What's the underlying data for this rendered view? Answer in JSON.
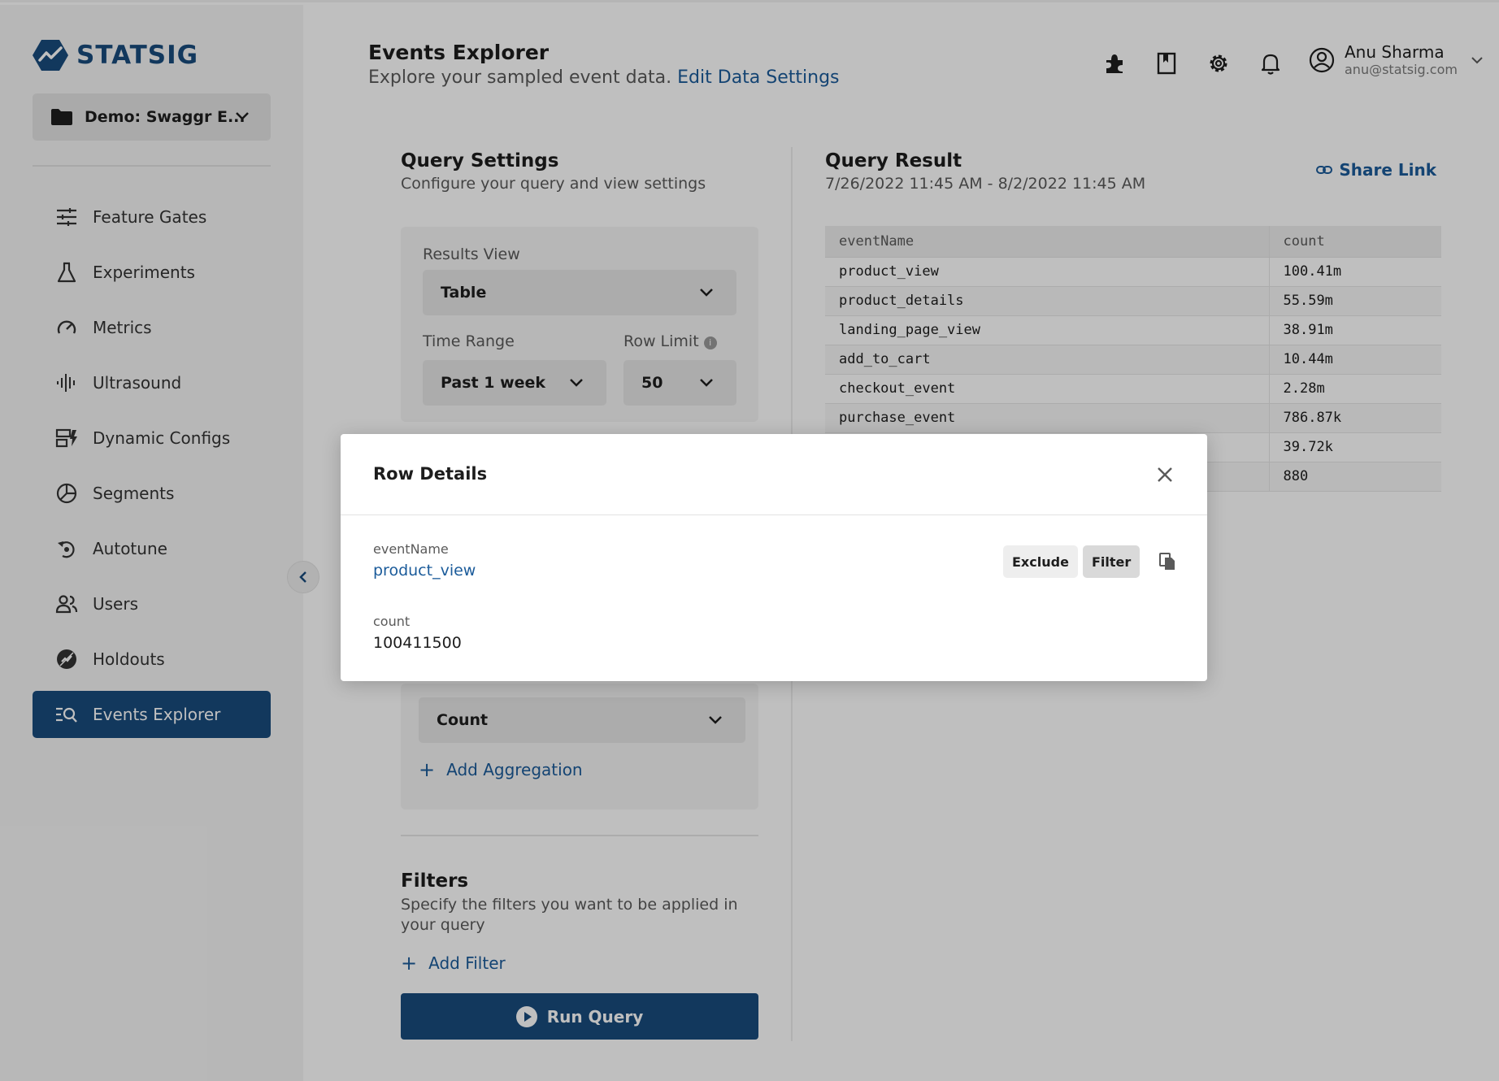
{
  "brand": {
    "name": "STATSIG",
    "color": "#194b7d"
  },
  "project": {
    "name": "Demo: Swaggr E...",
    "icon": "folder-icon"
  },
  "sidebar": {
    "items": [
      {
        "label": "Feature Gates",
        "icon": "feature-gates-icon"
      },
      {
        "label": "Experiments",
        "icon": "flask-icon"
      },
      {
        "label": "Metrics",
        "icon": "gauge-icon"
      },
      {
        "label": "Ultrasound",
        "icon": "waveform-icon"
      },
      {
        "label": "Dynamic Configs",
        "icon": "dynamic-configs-icon"
      },
      {
        "label": "Segments",
        "icon": "segments-icon"
      },
      {
        "label": "Autotune",
        "icon": "autotune-icon"
      },
      {
        "label": "Users",
        "icon": "users-icon"
      },
      {
        "label": "Holdouts",
        "icon": "holdouts-icon"
      },
      {
        "label": "Events Explorer",
        "icon": "events-explorer-icon",
        "active": true
      }
    ]
  },
  "header": {
    "title": "Events Explorer",
    "subtitle": "Explore your sampled event data.",
    "edit_link": "Edit Data Settings",
    "icons": [
      "puzzle-icon",
      "bookmark-icon",
      "gear-icon",
      "bell-icon"
    ],
    "user": {
      "name": "Anu Sharma",
      "email": "anu@statsig.com"
    }
  },
  "query_settings": {
    "title": "Query Settings",
    "subtitle": "Configure your query and view settings",
    "results_view_label": "Results View",
    "results_view_value": "Table",
    "time_range_label": "Time Range",
    "time_range_value": "Past 1 week",
    "row_limit_label": "Row Limit",
    "row_limit_value": "50",
    "aggregation_value": "Count",
    "add_aggregation": "Add Aggregation",
    "filters_title": "Filters",
    "filters_subtitle": "Specify the filters you want to be applied in your query",
    "add_filter": "Add Filter",
    "run_query": "Run Query"
  },
  "query_result": {
    "title": "Query Result",
    "range": "7/26/2022 11:45 AM - 8/2/2022 11:45 AM",
    "share_link": "Share Link",
    "columns": [
      "eventName",
      "count"
    ],
    "rows": [
      [
        "product_view",
        "100.41m"
      ],
      [
        "product_details",
        "55.59m"
      ],
      [
        "landing_page_view",
        "38.91m"
      ],
      [
        "add_to_cart",
        "10.44m"
      ],
      [
        "checkout_event",
        "2.28m"
      ],
      [
        "purchase_event",
        "786.87k"
      ],
      [
        "",
        "39.72k"
      ],
      [
        "",
        "880"
      ]
    ]
  },
  "modal": {
    "title": "Row Details",
    "field1_label": "eventName",
    "field1_value": "product_view",
    "field2_label": "count",
    "field2_value": "100411500",
    "exclude": "Exclude",
    "filter": "Filter"
  }
}
